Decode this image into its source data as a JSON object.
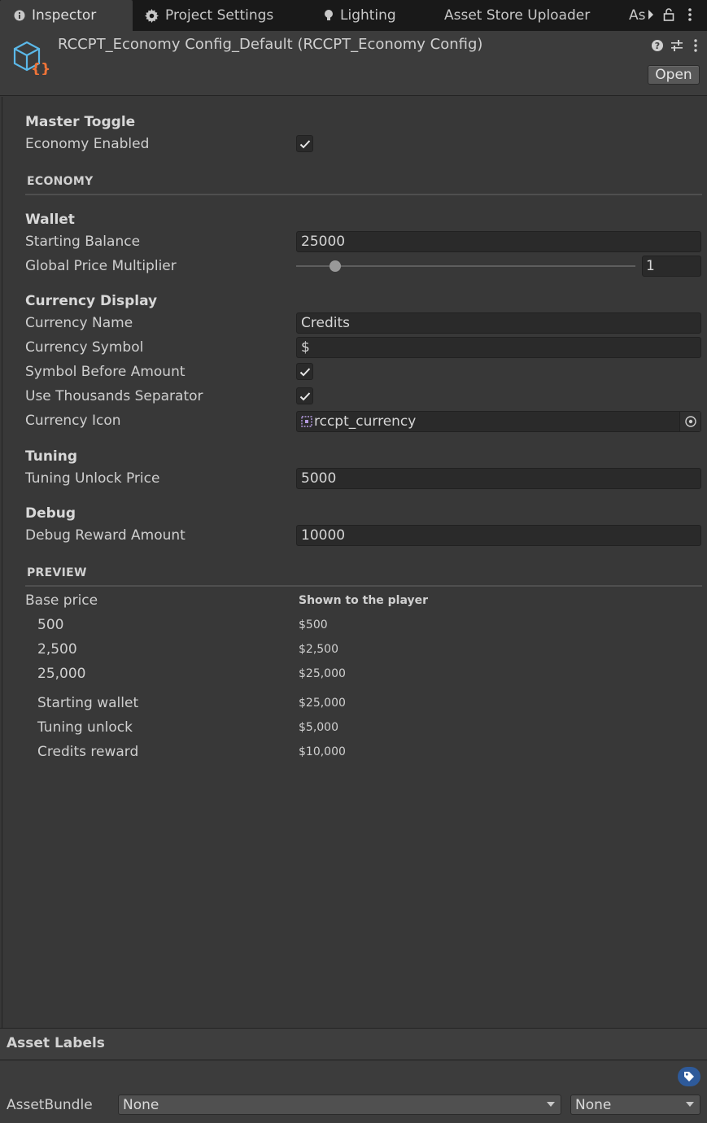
{
  "tabs": [
    {
      "label": "Inspector",
      "icon": "info-icon"
    },
    {
      "label": "Project Settings",
      "icon": "gear-icon"
    },
    {
      "label": "Lighting",
      "icon": "bulb-icon"
    },
    {
      "label": "Asset Store Uploader"
    },
    {
      "label": "As"
    }
  ],
  "header": {
    "title": "RCCPT_Economy Config_Default (RCCPT_Economy Config)",
    "open_label": "Open"
  },
  "master": {
    "heading": "Master Toggle",
    "economy_enabled_label": "Economy Enabled",
    "economy_enabled": true
  },
  "economy": {
    "section_label": "ECONOMY",
    "wallet_heading": "Wallet",
    "starting_balance_label": "Starting Balance",
    "starting_balance": "25000",
    "global_price_multiplier_label": "Global Price Multiplier",
    "global_price_multiplier": "1",
    "slider_fraction": 0.115,
    "currency_display_heading": "Currency Display",
    "currency_name_label": "Currency Name",
    "currency_name": "Credits",
    "currency_symbol_label": "Currency Symbol",
    "currency_symbol": "$",
    "symbol_before_amount_label": "Symbol Before Amount",
    "symbol_before_amount": true,
    "use_thousands_separator_label": "Use Thousands Separator",
    "use_thousands_separator": true,
    "currency_icon_label": "Currency Icon",
    "currency_icon": "rccpt_currency",
    "tuning_heading": "Tuning",
    "tuning_unlock_price_label": "Tuning Unlock Price",
    "tuning_unlock_price": "5000",
    "debug_heading": "Debug",
    "debug_reward_amount_label": "Debug Reward Amount",
    "debug_reward_amount": "10000"
  },
  "preview": {
    "section_label": "PREVIEW",
    "col_base": "Base price",
    "col_shown": "Shown to the player",
    "rows": [
      {
        "label": "500",
        "value": "$500"
      },
      {
        "label": "2,500",
        "value": "$2,500"
      },
      {
        "label": "25,000",
        "value": "$25,000"
      },
      {
        "label": "Starting wallet",
        "value": "$25,000"
      },
      {
        "label": "Tuning unlock",
        "value": "$5,000"
      },
      {
        "label": "Credits reward",
        "value": "$10,000"
      }
    ]
  },
  "footer": {
    "asset_labels": "Asset Labels",
    "assetbundle_label": "AssetBundle",
    "bundle_name": "None",
    "bundle_variant": "None"
  },
  "colors": {
    "accent_blue": "#2e5a9a",
    "icon_cyan": "#5bb8e8",
    "icon_orange": "#f07438"
  }
}
